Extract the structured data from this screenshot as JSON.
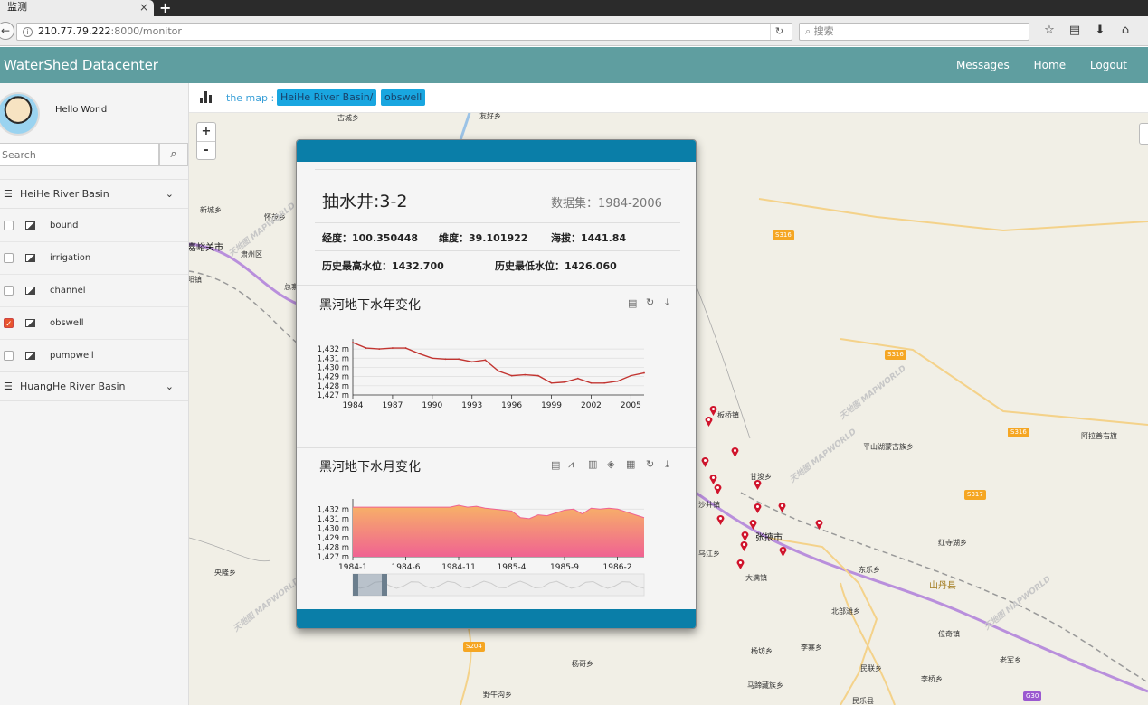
{
  "browser": {
    "tab_title": "监测",
    "tab_close": "×",
    "new_tab": "+",
    "url_host": "210.77.79.222",
    "url_path": ":8000/monitor",
    "search_placeholder": "搜索"
  },
  "app": {
    "brand": "WaterShed Datacenter",
    "nav": [
      "Messages",
      "Home",
      "Logout"
    ]
  },
  "sidebar": {
    "username": "Hello World",
    "search_placeholder": "Search",
    "groups": [
      {
        "label": "HeiHe River Basin"
      },
      {
        "label": "HuangHe River Basin"
      }
    ],
    "layers": [
      {
        "label": "bound",
        "checked": false
      },
      {
        "label": "irrigation",
        "checked": false
      },
      {
        "label": "channel",
        "checked": false
      },
      {
        "label": "obswell",
        "checked": true
      },
      {
        "label": "pumpwell",
        "checked": false
      }
    ]
  },
  "mapbar": {
    "label": "the map :",
    "crumbs": [
      "HeiHe River Basin/",
      "obswell"
    ]
  },
  "map": {
    "zoom_in": "+",
    "zoom_out": "-",
    "places": [
      "古城乡",
      "友好乡",
      "新城乡",
      "怀茂乡",
      "嘉峪关市",
      "肃州区",
      "阳镇",
      "总寨",
      "板桥镇",
      "平山湖蒙古族乡",
      "阿拉善右旗",
      "甘浚乡",
      "沙井镇",
      "张掖市",
      "大满镇",
      "东乐乡",
      "红寺湖乡",
      "山丹县",
      "北部滩乡",
      "位奇镇",
      "杨坊乡",
      "李寨乡",
      "老军乡",
      "民联乡",
      "李桥乡",
      "马蹄藏族乡",
      "民乐县",
      "杨哥乡",
      "野牛沟乡",
      "央隆乡",
      "乌江乡"
    ],
    "roads": [
      "S316",
      "S316",
      "S316",
      "S317",
      "S204",
      "G30"
    ],
    "watermark": "天地图 MAPWORLD"
  },
  "popup": {
    "title": "抽水井:3-2",
    "dataset": "数据集：1984-2006",
    "lng": "经度：100.350448",
    "lat": "维度：39.101922",
    "alt": "海拔：1441.84",
    "max_level": "历史最高水位：1432.700",
    "min_level": "历史最低水位：1426.060"
  },
  "chart_data": [
    {
      "type": "line",
      "title": "黑河地下水年变化",
      "x": [
        "1984",
        "1985",
        "1986",
        "1987",
        "1988",
        "1989",
        "1990",
        "1991",
        "1992",
        "1993",
        "1994",
        "1995",
        "1996",
        "1997",
        "1998",
        "1999",
        "2000",
        "2001",
        "2002",
        "2003",
        "2004",
        "2005",
        "2006"
      ],
      "xticks": [
        "1984",
        "1987",
        "1990",
        "1993",
        "1996",
        "1999",
        "2002",
        "2005"
      ],
      "yticks": [
        "1,432 m",
        "1,431 m",
        "1,430 m",
        "1,429 m",
        "1,428 m",
        "1,427 m"
      ],
      "ylim": [
        1427,
        1432.5
      ],
      "values": [
        1432.7,
        1432.1,
        1432.0,
        1432.1,
        1432.1,
        1431.5,
        1431.0,
        1430.9,
        1430.9,
        1430.6,
        1430.8,
        1429.6,
        1429.1,
        1429.2,
        1429.1,
        1428.3,
        1428.4,
        1428.8,
        1428.3,
        1428.3,
        1428.5,
        1429.1,
        1429.4
      ],
      "color": "#c23531"
    },
    {
      "type": "area",
      "title": "黑河地下水月变化",
      "xticks": [
        "1984-1",
        "1984-6",
        "1984-11",
        "1985-4",
        "1985-9",
        "1986-2"
      ],
      "yticks": [
        "1,432 m",
        "1,431 m",
        "1,430 m",
        "1,429 m",
        "1,428 m",
        "1,427 m"
      ],
      "ylim": [
        1427,
        1432.5
      ],
      "values": [
        1432.2,
        1432.2,
        1432.2,
        1432.2,
        1432.2,
        1432.2,
        1432.2,
        1432.2,
        1432.2,
        1432.2,
        1432.2,
        1432.2,
        1432.4,
        1432.2,
        1432.3,
        1432.1,
        1432.0,
        1431.9,
        1431.8,
        1431.1,
        1431.0,
        1431.4,
        1431.3,
        1431.6,
        1431.9,
        1432.0,
        1431.5,
        1432.1,
        1432.0,
        1432.1,
        1432.0,
        1431.7,
        1431.4,
        1431.1
      ],
      "gradient": [
        "#f7b267",
        "#f06292"
      ]
    }
  ]
}
